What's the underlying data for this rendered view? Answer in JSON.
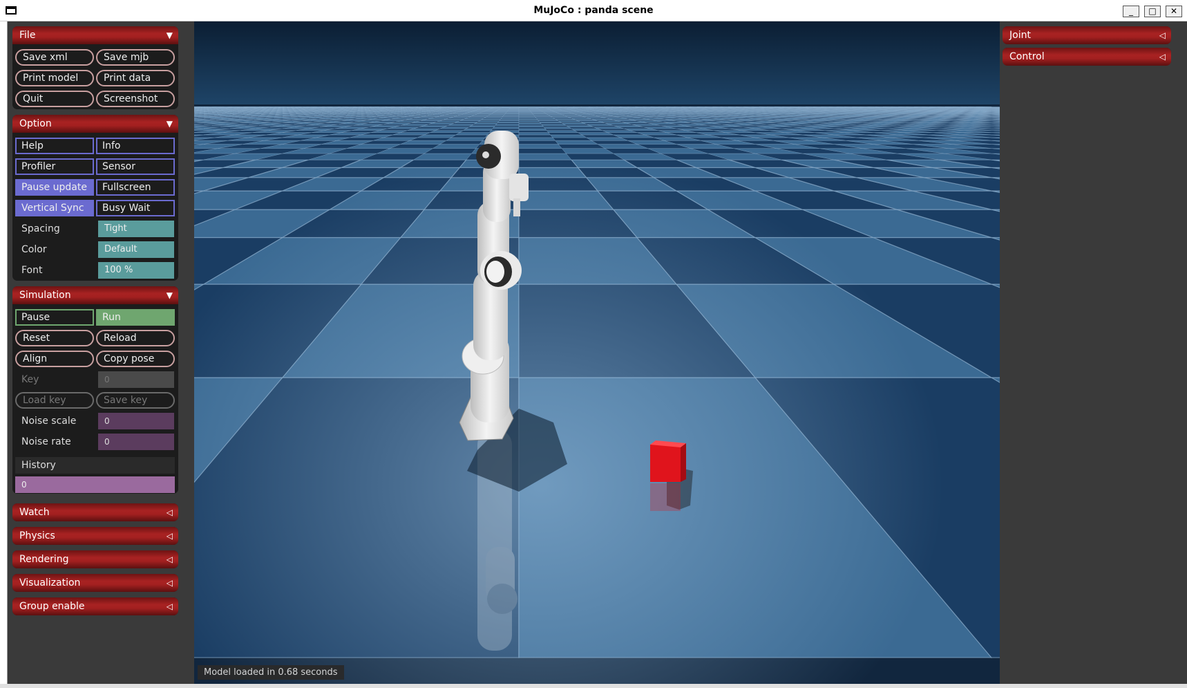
{
  "window": {
    "title": "MuJoCo : panda scene",
    "minimize_glyph": "_",
    "maximize_glyph": "□",
    "close_glyph": "✕"
  },
  "left_panel": {
    "file": {
      "header": "File",
      "arrow": "▼",
      "buttons": [
        "Save xml",
        "Save mjb",
        "Print model",
        "Print data",
        "Quit",
        "Screenshot"
      ]
    },
    "option": {
      "header": "Option",
      "arrow": "▼",
      "checkboxes": [
        {
          "label": "Help",
          "checked": false
        },
        {
          "label": "Info",
          "checked": false
        },
        {
          "label": "Profiler",
          "checked": false
        },
        {
          "label": "Sensor",
          "checked": false
        },
        {
          "label": "Pause update",
          "checked": true
        },
        {
          "label": "Fullscreen",
          "checked": false
        },
        {
          "label": "Vertical Sync",
          "checked": true
        },
        {
          "label": "Busy Wait",
          "checked": false
        }
      ],
      "spacing_label": "Spacing",
      "spacing_value": "Tight",
      "color_label": "Color",
      "color_value": "Default",
      "font_label": "Font",
      "font_value": "100 %"
    },
    "simulation": {
      "header": "Simulation",
      "arrow": "▼",
      "pause_label": "Pause",
      "run_label": "Run",
      "run_selected": true,
      "buttons": [
        "Reset",
        "Reload",
        "Align",
        "Copy pose"
      ],
      "key_label": "Key",
      "key_value": "0",
      "load_key": "Load key",
      "save_key": "Save key",
      "noise_scale_label": "Noise scale",
      "noise_scale_value": "0",
      "noise_rate_label": "Noise rate",
      "noise_rate_value": "0",
      "history_label": "History",
      "history_value": "0"
    },
    "collapsed_sections": [
      {
        "label": "Watch",
        "arrow": "◁"
      },
      {
        "label": "Physics",
        "arrow": "◁"
      },
      {
        "label": "Rendering",
        "arrow": "◁"
      },
      {
        "label": "Visualization",
        "arrow": "◁"
      },
      {
        "label": "Group enable",
        "arrow": "◁"
      }
    ]
  },
  "right_panel": {
    "sections": [
      {
        "label": "Joint",
        "arrow": "◁"
      },
      {
        "label": "Control",
        "arrow": "◁"
      }
    ]
  },
  "viewport": {
    "status_message": "Model loaded in 0.68 seconds",
    "colors": {
      "floor_light": "#3b6a93",
      "floor_dark": "#1a3d63",
      "robot": "#e6e6e6",
      "cube": "#e0141c",
      "sky": "#0d2238"
    }
  }
}
